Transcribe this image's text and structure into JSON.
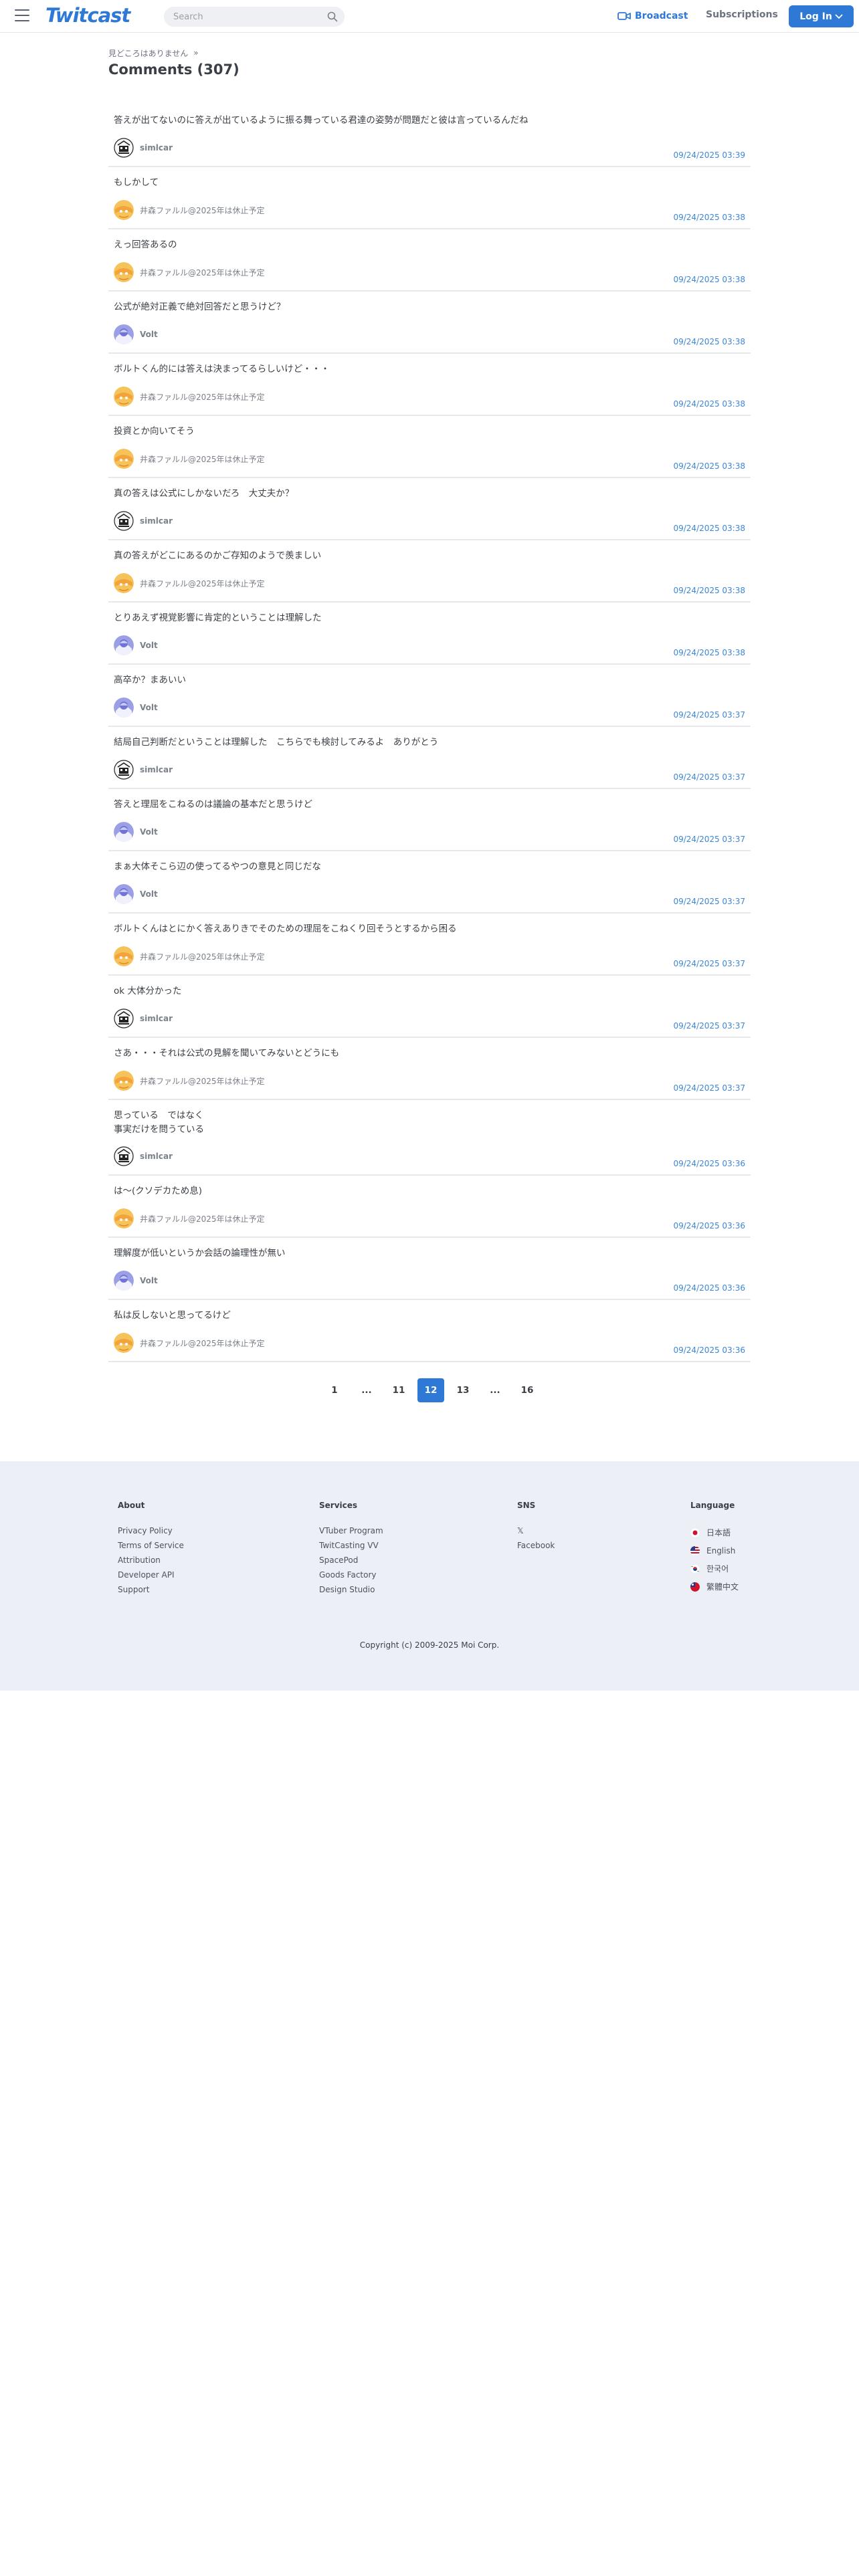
{
  "header": {
    "logo": "Twitcast",
    "search_placeholder": "Search",
    "broadcast_label": "Broadcast",
    "subscriptions_label": "Subscriptions",
    "login_label": "Log In",
    "accent": "#2e79d6"
  },
  "breadcrumb": {
    "parent": "見どころはありません",
    "separator": "»"
  },
  "page_title": "Comments (307)",
  "comments": [
    {
      "text": "答えが出てないのに答えが出ているように振る舞っている君達の姿勢が問題だと彼は言っているんだね",
      "user": "simlcar",
      "time": "09/24/2025 03:39",
      "avatar": "simlcar"
    },
    {
      "text": "もしかして",
      "user": "井森ファルル@2025年は休止予定",
      "time": "09/24/2025 03:38",
      "avatar": "farulu"
    },
    {
      "text": "えっ回答あるの",
      "user": "井森ファルル@2025年は休止予定",
      "time": "09/24/2025 03:38",
      "avatar": "farulu"
    },
    {
      "text": "公式が絶対正義で絶対回答だと思うけど？",
      "user": "Volt",
      "time": "09/24/2025 03:38",
      "avatar": "volt"
    },
    {
      "text": "ボルトくん的には答えは決まってるらしいけど・・・",
      "user": "井森ファルル@2025年は休止予定",
      "time": "09/24/2025 03:38",
      "avatar": "farulu"
    },
    {
      "text": "投資とか向いてそう",
      "user": "井森ファルル@2025年は休止予定",
      "time": "09/24/2025 03:38",
      "avatar": "farulu"
    },
    {
      "text": "真の答えは公式にしかないだろ　大丈夫か？",
      "user": "simlcar",
      "time": "09/24/2025 03:38",
      "avatar": "simlcar"
    },
    {
      "text": "真の答えがどこにあるのかご存知のようで羨ましい",
      "user": "井森ファルル@2025年は休止予定",
      "time": "09/24/2025 03:38",
      "avatar": "farulu"
    },
    {
      "text": "とりあえず視覚影響に肯定的ということは理解した",
      "user": "Volt",
      "time": "09/24/2025 03:38",
      "avatar": "volt"
    },
    {
      "text": "高卒か？まあいい",
      "user": "Volt",
      "time": "09/24/2025 03:37",
      "avatar": "volt"
    },
    {
      "text": "結局自己判断だということは理解した　こちらでも検討してみるよ　ありがとう",
      "user": "simlcar",
      "time": "09/24/2025 03:37",
      "avatar": "simlcar"
    },
    {
      "text": "答えと理屈をこねるのは議論の基本だと思うけど",
      "user": "Volt",
      "time": "09/24/2025 03:37",
      "avatar": "volt"
    },
    {
      "text": "まぁ大体そこら辺の使ってるやつの意見と同じだな",
      "user": "Volt",
      "time": "09/24/2025 03:37",
      "avatar": "volt"
    },
    {
      "text": "ボルトくんはとにかく答えありきでそのための理屈をこねくり回そうとするから困る",
      "user": "井森ファルル@2025年は休止予定",
      "time": "09/24/2025 03:37",
      "avatar": "farulu"
    },
    {
      "text": "ok 大体分かった",
      "user": "simlcar",
      "time": "09/24/2025 03:37",
      "avatar": "simlcar"
    },
    {
      "text": "さあ・・・それは公式の見解を聞いてみないとどうにも",
      "user": "井森ファルル@2025年は休止予定",
      "time": "09/24/2025 03:37",
      "avatar": "farulu"
    },
    {
      "text": "思っている　ではなく\n事実だけを問うている",
      "user": "simlcar",
      "time": "09/24/2025 03:36",
      "avatar": "simlcar",
      "tall": true
    },
    {
      "text": "は〜(クソデカため息)",
      "user": "井森ファルル@2025年は休止予定",
      "time": "09/24/2025 03:36",
      "avatar": "farulu"
    },
    {
      "text": "理解度が低いというか会話の論理性が無い",
      "user": "Volt",
      "time": "09/24/2025 03:36",
      "avatar": "volt"
    },
    {
      "text": "私は反しないと思ってるけど",
      "user": "井森ファルル@2025年は休止予定",
      "time": "09/24/2025 03:36",
      "avatar": "farulu"
    }
  ],
  "pagination": {
    "pages": [
      "1",
      "...",
      "11",
      "12",
      "13",
      "...",
      "16"
    ],
    "active": "12"
  },
  "footer": {
    "about": {
      "heading": "About",
      "links": [
        "Privacy Policy",
        "Terms of Service",
        "Attribution",
        "Developer API",
        "Support"
      ]
    },
    "services": {
      "heading": "Services",
      "links": [
        "VTuber Program",
        "TwitCasting VV",
        "SpacePod",
        "Goods Factory",
        "Design Studio"
      ]
    },
    "sns": {
      "heading": "SNS",
      "links": [
        "𝕏",
        "Facebook"
      ]
    },
    "language": {
      "heading": "Language",
      "items": [
        {
          "label": "日本語",
          "flag": "jp-flag"
        },
        {
          "label": "English",
          "flag": "us-flag"
        },
        {
          "label": "한국어",
          "flag": "kr-flag"
        },
        {
          "label": "繁體中文",
          "flag": "tw-flag"
        }
      ]
    },
    "copyright": "Copyright (c) 2009-2025 Moi Corp."
  }
}
